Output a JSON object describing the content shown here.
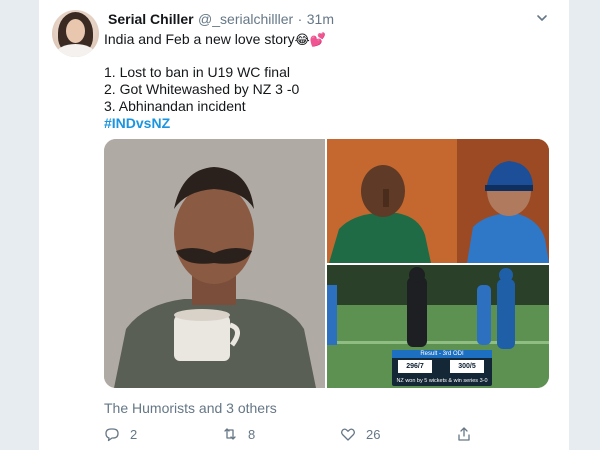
{
  "tweet": {
    "author_name": "Serial Chiller",
    "handle": "@_serialchilller",
    "separator": "·",
    "time": "31m",
    "line1": "India and Feb a new love story",
    "line1_emoji": "😂💕",
    "items": [
      "1. Lost to ban in U19 WC final",
      "2. Got Whitewashed by NZ 3 -0",
      "3. Abhinandan incident"
    ],
    "hashtag": "#INDvsNZ",
    "social_context": "The Humorists and 3 others"
  },
  "scoreboard": {
    "header": "Result - 3rd ODI",
    "team1_score": "296/7",
    "team2_score": "300/5",
    "footer": "NZ won by 5 wickets & win series 3-0"
  },
  "actions": {
    "reply_count": "2",
    "retweet_count": "8",
    "like_count": "26"
  },
  "icons": {
    "more": "chevron-down-icon",
    "reply": "reply-icon",
    "retweet": "retweet-icon",
    "like": "heart-icon",
    "share": "share-icon"
  },
  "colors": {
    "link": "#1b95e0",
    "muted": "#657786",
    "text": "#14171a",
    "background": "#e6ecf0"
  }
}
